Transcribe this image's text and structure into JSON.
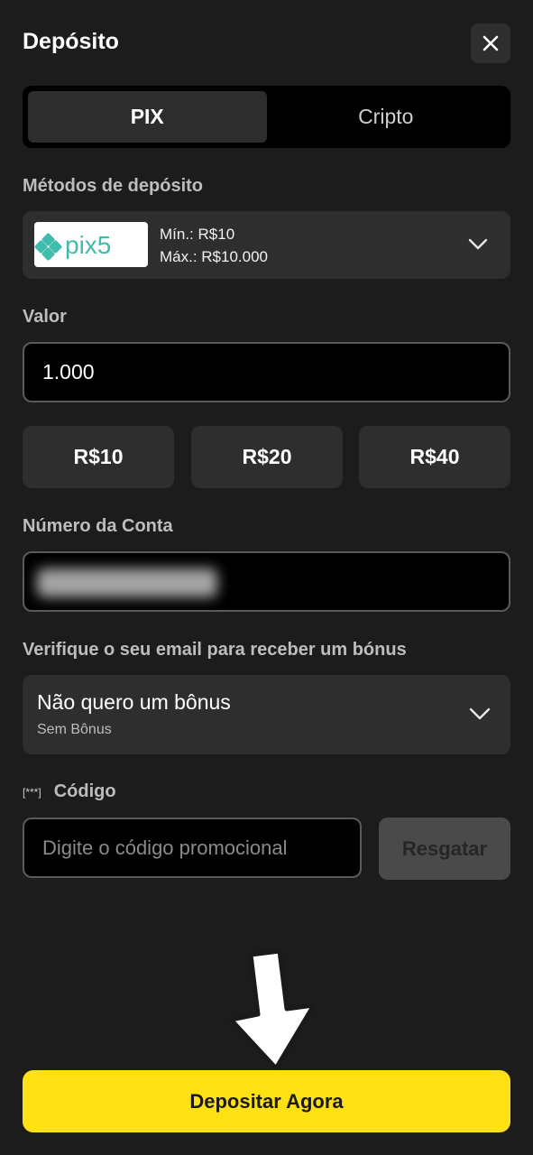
{
  "header": {
    "title": "Depósito",
    "close_icon": "close-icon"
  },
  "tabs": [
    {
      "label": "PIX",
      "active": true
    },
    {
      "label": "Cripto",
      "active": false
    }
  ],
  "deposit_methods": {
    "label": "Métodos de depósito",
    "selected": {
      "logo_text": "pix5",
      "min": "Mín.: R$10",
      "max": "Máx.: R$10.000"
    }
  },
  "amount": {
    "label": "Valor",
    "value": "1.000",
    "quick_options": [
      "R$10",
      "R$20",
      "R$40"
    ]
  },
  "account": {
    "label": "Número da Conta"
  },
  "bonus": {
    "label": "Verifique o seu email para receber um bónus",
    "selected": "Não quero um bônus",
    "sub": "Sem Bônus"
  },
  "code": {
    "icon_text": "[***]",
    "label": "Código",
    "placeholder": "Digite o código promocional",
    "redeem_label": "Resgatar"
  },
  "cta": {
    "label": "Depositar Agora"
  },
  "colors": {
    "accent": "#fde114",
    "background": "#1c1c1c",
    "pix_teal": "#3fbcab"
  }
}
